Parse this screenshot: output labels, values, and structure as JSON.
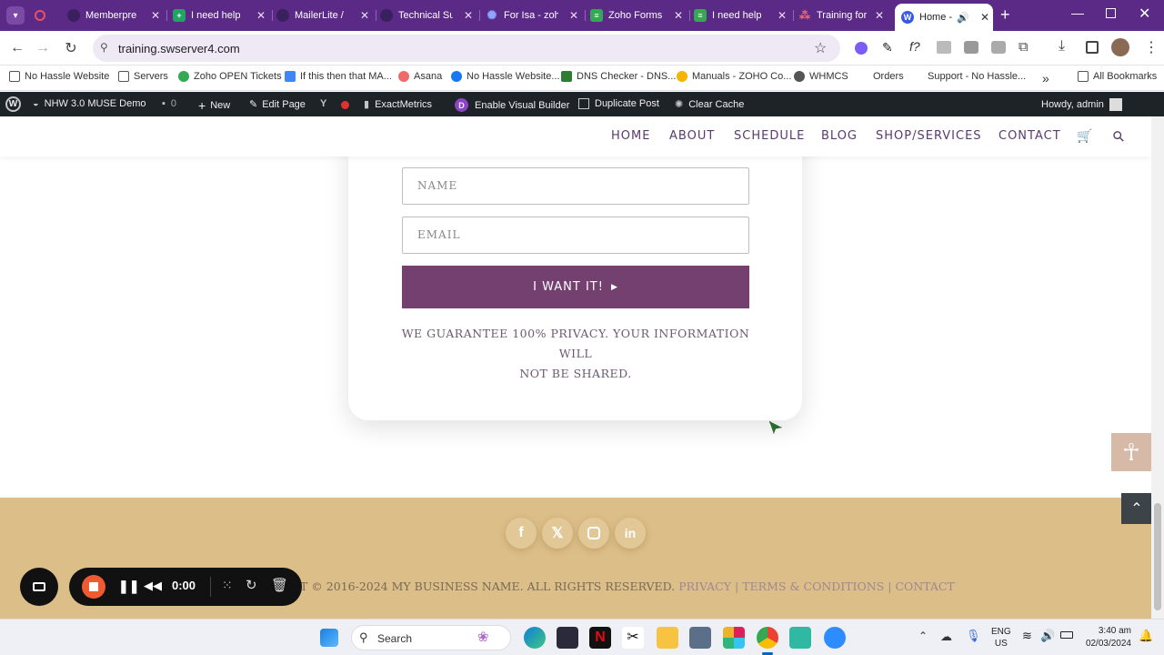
{
  "browser": {
    "tabs": [
      {
        "label": "",
        "icon": "record-icon",
        "color": "#e8506a"
      },
      {
        "label": "Memberpre",
        "icon": "memberpress-icon",
        "color": "#3b2060"
      },
      {
        "label": "I need help",
        "icon": "sheets-icon",
        "color": "#1fa463"
      },
      {
        "label": "MailerLite / ",
        "icon": "mailerlite-icon",
        "color": "#3b2060"
      },
      {
        "label": "Technical Su",
        "icon": "zoho-icon",
        "color": "#3b2060"
      },
      {
        "label": "For Isa - zoh",
        "icon": "gear-icon",
        "color": "#4a6ee0"
      },
      {
        "label": "Zoho Forms",
        "icon": "forms-icon",
        "color": "#34a853"
      },
      {
        "label": "I need help",
        "icon": "forms-icon",
        "color": "#34a853"
      },
      {
        "label": "Training for",
        "icon": "asana-icon",
        "color": "#f06a6a"
      },
      {
        "label": "Home -",
        "icon": "wordpress-icon",
        "color": "#3858e9"
      }
    ],
    "url": "training.swserver4.com",
    "bookmarks": [
      {
        "label": "No Hassle Website",
        "color": "#888"
      },
      {
        "label": "Servers",
        "color": "#888"
      },
      {
        "label": "Zoho OPEN Tickets",
        "color": "#34a853"
      },
      {
        "label": "If this then that MA...",
        "color": "#4285f4"
      },
      {
        "label": "Asana",
        "color": "#f06a6a"
      },
      {
        "label": "No Hassle Website...",
        "color": "#1877f2"
      },
      {
        "label": "DNS Checker - DNS...",
        "color": "#2e7d32"
      },
      {
        "label": "Manuals - ZOHO Co...",
        "color": "#f4b400"
      },
      {
        "label": "WHMCS",
        "color": "#555"
      },
      {
        "label": "Orders",
        "color": "#bbb"
      },
      {
        "label": "Support - No Hassle...",
        "color": "#bbb"
      }
    ],
    "all_bookmarks": "All Bookmarks"
  },
  "wpadmin": {
    "site": "NHW 3.0 MUSE Demo",
    "comments": "0",
    "new": "New",
    "edit": "Edit Page",
    "exactmetrics": "ExactMetrics",
    "builder": "Enable Visual Builder",
    "duplicate": "Duplicate Post",
    "cache": "Clear Cache",
    "howdy": "Howdy, admin"
  },
  "site": {
    "nav": [
      "HOME",
      "ABOUT",
      "SCHEDULE",
      "BLOG",
      "SHOP/SERVICES",
      "CONTACT"
    ],
    "form": {
      "name_placeholder": "NAME",
      "email_placeholder": "EMAIL",
      "button": "I WANT IT!",
      "privacy_line1": "WE GUARANTEE 100% PRIVACY. YOUR INFORMATION WILL",
      "privacy_line2": "NOT BE SHARED."
    },
    "footer": {
      "copyright": "T © 2016-2024 MY BUSINESS NAME. ALL RIGHTS RESERVED.",
      "privacy": "PRIVACY",
      "terms": "TERMS & CONDITIONS",
      "contact": "CONTACT",
      "sep": "|"
    }
  },
  "recorder": {
    "time": "0:00"
  },
  "taskbar": {
    "search": "Search",
    "lang": "ENG",
    "region": "US",
    "time": "3:40 am",
    "date": "02/03/2024"
  }
}
